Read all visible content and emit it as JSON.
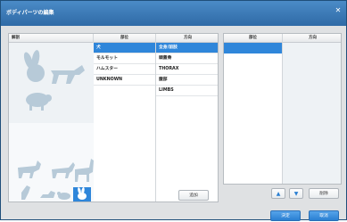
{
  "window": {
    "title": "ボディパーツの編集"
  },
  "left_panel": {
    "col1": "解剖",
    "col2": "部位",
    "col3": "方向",
    "part_list": [
      "犬",
      "モルモット",
      "ハムスター",
      "UNKNOWN"
    ],
    "direction_list": [
      "全身/前肢",
      "頭蓋骨",
      "THORAX",
      "腹部",
      "LIMBS"
    ],
    "selected_part": "犬",
    "selected_direction": "全身/前肢"
  },
  "right_panel": {
    "col1": "部位",
    "col2": "方向"
  },
  "buttons": {
    "add": "追加",
    "up": "▲",
    "down": "▼",
    "delete": "削除",
    "ok": "決定",
    "cancel": "取消"
  },
  "icons": {
    "silhouettes": [
      "rabbit-icon",
      "dog-icon",
      "pig-icon",
      "cat-icon",
      "goat-icon",
      "horse-icon",
      "parrot-icon",
      "duck-icon",
      "mouse-icon",
      "rabbit-small-icon"
    ]
  },
  "colors": {
    "accent": "#2f86da",
    "title_bar": "#2f6aa6",
    "silhouette": "#b7cad8"
  }
}
